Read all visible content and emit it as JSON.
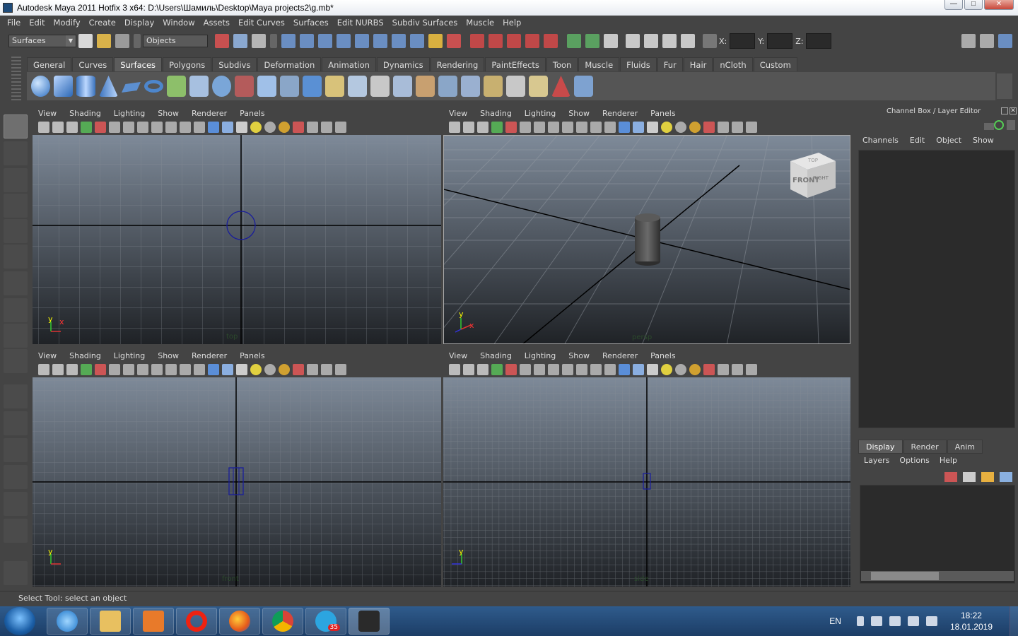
{
  "window": {
    "title": "Autodesk Maya 2011 Hotfix 3 x64: D:\\Users\\Шамиль\\Desktop\\Maya projects2\\g.mb*",
    "minimize": "—",
    "maximize": "□",
    "close": "✕"
  },
  "menubar": [
    "File",
    "Edit",
    "Modify",
    "Create",
    "Display",
    "Window",
    "Assets",
    "Edit Curves",
    "Surfaces",
    "Edit NURBS",
    "Subdiv Surfaces",
    "Muscle",
    "Help"
  ],
  "statusline": {
    "menuset": "Surfaces",
    "selection_mode": "Objects",
    "x_label": "X:",
    "y_label": "Y:",
    "z_label": "Z:"
  },
  "shelf": {
    "tabs": [
      "General",
      "Curves",
      "Surfaces",
      "Polygons",
      "Subdivs",
      "Deformation",
      "Animation",
      "Dynamics",
      "Rendering",
      "PaintEffects",
      "Toon",
      "Muscle",
      "Fluids",
      "Fur",
      "Hair",
      "nCloth",
      "Custom"
    ],
    "active_tab": "Surfaces"
  },
  "panels": {
    "menu": [
      "View",
      "Shading",
      "Lighting",
      "Show",
      "Renderer",
      "Panels"
    ],
    "top_left_camera": "top",
    "top_right_camera": "persp",
    "bottom_left_camera": "front",
    "bottom_right_camera": "side",
    "view_cube_front": "FRONT",
    "view_cube_right": "RIGHT",
    "view_cube_top": "TOP",
    "axis_y": "y",
    "axis_x": "x",
    "axis_z": "z"
  },
  "channelbox": {
    "header": "Channel Box / Layer Editor",
    "menu": [
      "Channels",
      "Edit",
      "Object",
      "Show"
    ],
    "layer_tabs": [
      "Display",
      "Render",
      "Anim"
    ],
    "active_layer_tab": "Display",
    "layer_menu": [
      "Layers",
      "Options",
      "Help"
    ]
  },
  "helpline": "Select Tool: select an object",
  "taskbar": {
    "telegram_badge": "35",
    "language": "EN",
    "time": "18:22",
    "date": "18.01.2019"
  },
  "colors": {
    "viewport_top": "#7e8a99",
    "viewport_bottom": "#1f2226",
    "grid": "#8a8f96",
    "selection_blue": "#1a1e9a"
  }
}
